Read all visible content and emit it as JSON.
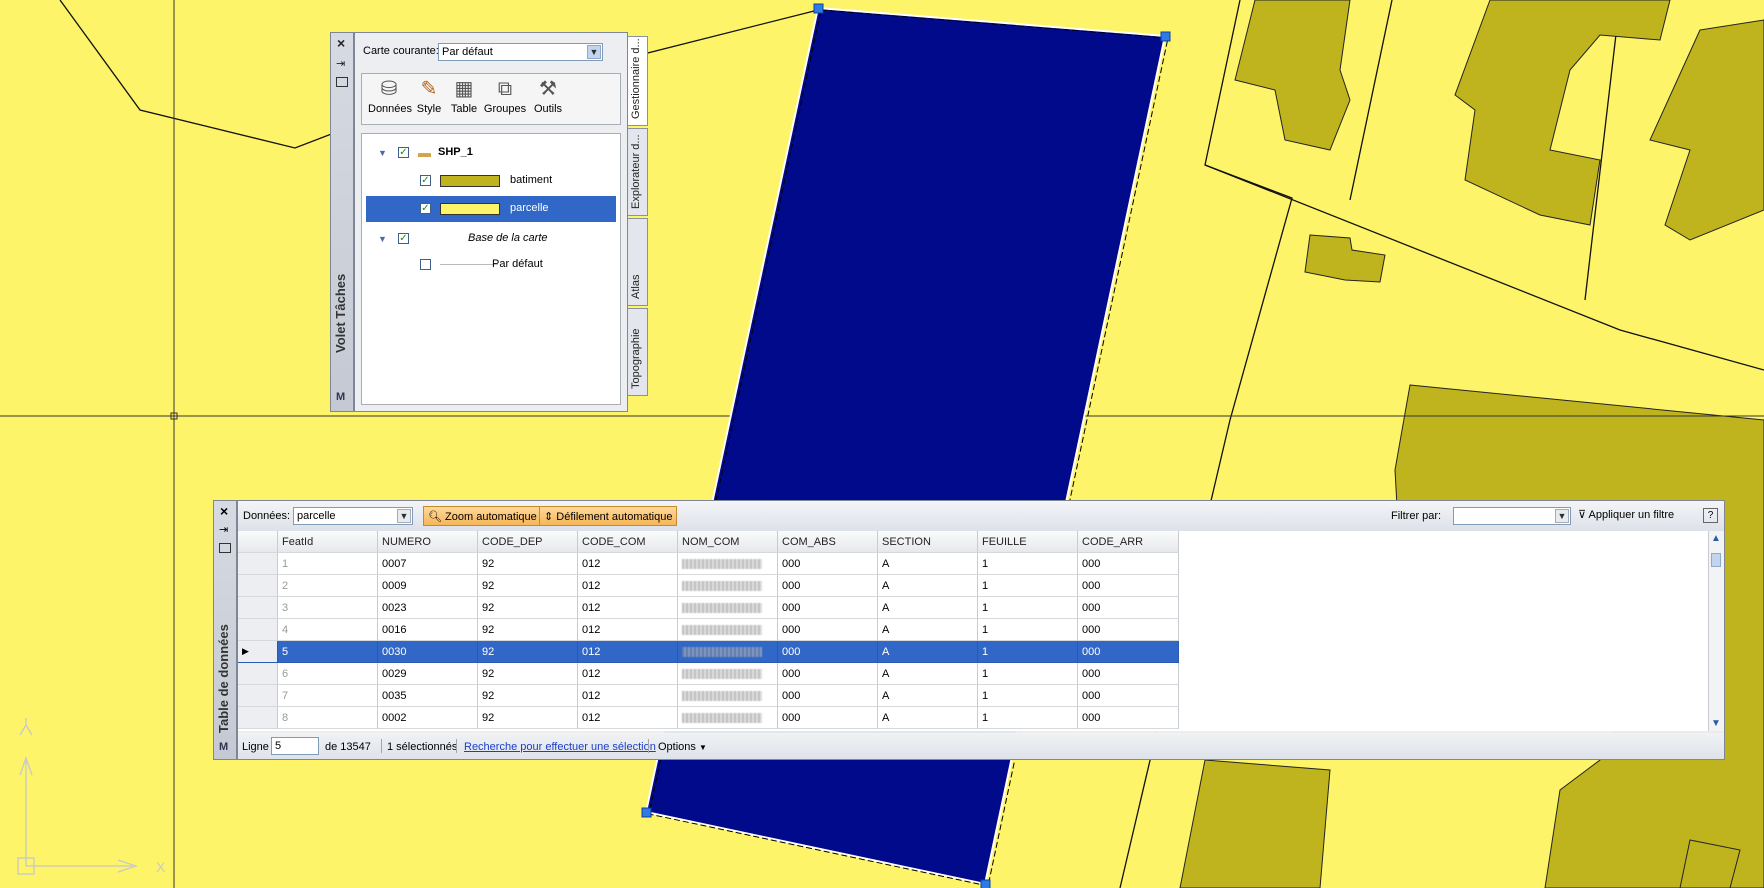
{
  "colors": {
    "parcel": "#fdf46a",
    "building": "#c0b41e",
    "selected_parcel": "#020a8c",
    "selection_row": "#3168c8",
    "orange_button": "#f5b658"
  },
  "task_pane": {
    "title": "Volet Tâches",
    "logo": "M",
    "current_map_label": "Carte courante:",
    "current_map_value": "Par défaut",
    "tabs": [
      "Gestionnaire d...",
      "Explorateur d...",
      "Atlas",
      "Topographie"
    ],
    "toolbar": [
      {
        "label": "Données",
        "icon": "database-icon"
      },
      {
        "label": "Style",
        "icon": "brush-icon"
      },
      {
        "label": "Table",
        "icon": "table-icon"
      },
      {
        "label": "Groupes",
        "icon": "groups-icon"
      },
      {
        "label": "Outils",
        "icon": "tools-icon"
      }
    ],
    "tree": {
      "group_name": "SHP_1",
      "layers": [
        {
          "name": "batiment",
          "checked": true,
          "swatch": "#c0b41e",
          "selected": false
        },
        {
          "name": "parcelle",
          "checked": true,
          "swatch": "#fdf46a",
          "selected": true
        }
      ],
      "base_name": "Base de la carte",
      "base_item": "Par défaut"
    }
  },
  "data_table": {
    "title": "Table de données",
    "logo": "M",
    "data_label": "Données:",
    "data_value": "parcelle",
    "zoom_button": "Zoom automatique",
    "scroll_button": "Défilement automatique",
    "filter_label": "Filtrer par:",
    "filter_value": "",
    "apply_filter": "Appliquer un filtre",
    "help": "?",
    "columns": [
      "FeatId",
      "NUMERO",
      "CODE_DEP",
      "CODE_COM",
      "NOM_COM",
      "COM_ABS",
      "SECTION",
      "FEUILLE",
      "CODE_ARR"
    ],
    "rows": [
      {
        "featid": "1",
        "numero": "0007",
        "code_dep": "92",
        "code_com": "012",
        "com_abs": "000",
        "section": "A",
        "feuille": "1",
        "code_arr": "000",
        "selected": false
      },
      {
        "featid": "2",
        "numero": "0009",
        "code_dep": "92",
        "code_com": "012",
        "com_abs": "000",
        "section": "A",
        "feuille": "1",
        "code_arr": "000",
        "selected": false
      },
      {
        "featid": "3",
        "numero": "0023",
        "code_dep": "92",
        "code_com": "012",
        "com_abs": "000",
        "section": "A",
        "feuille": "1",
        "code_arr": "000",
        "selected": false
      },
      {
        "featid": "4",
        "numero": "0016",
        "code_dep": "92",
        "code_com": "012",
        "com_abs": "000",
        "section": "A",
        "feuille": "1",
        "code_arr": "000",
        "selected": false
      },
      {
        "featid": "5",
        "numero": "0030",
        "code_dep": "92",
        "code_com": "012",
        "com_abs": "000",
        "section": "A",
        "feuille": "1",
        "code_arr": "000",
        "selected": true
      },
      {
        "featid": "6",
        "numero": "0029",
        "code_dep": "92",
        "code_com": "012",
        "com_abs": "000",
        "section": "A",
        "feuille": "1",
        "code_arr": "000",
        "selected": false
      },
      {
        "featid": "7",
        "numero": "0035",
        "code_dep": "92",
        "code_com": "012",
        "com_abs": "000",
        "section": "A",
        "feuille": "1",
        "code_arr": "000",
        "selected": false
      },
      {
        "featid": "8",
        "numero": "0002",
        "code_dep": "92",
        "code_com": "012",
        "com_abs": "000",
        "section": "A",
        "feuille": "1",
        "code_arr": "000",
        "selected": false
      }
    ],
    "status": {
      "line_label": "Ligne",
      "line_value": "5",
      "of_total": "de 13547",
      "selected": "1 sélectionnés",
      "search_link": "Recherche pour effectuer une sélection",
      "options": "Options"
    }
  },
  "ucs": {
    "y_label": "Y",
    "x_label": "X"
  }
}
